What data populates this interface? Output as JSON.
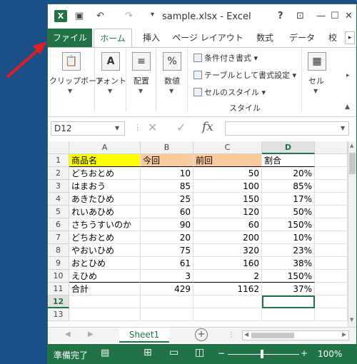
{
  "title_bar": {
    "title": "sample.xlsx - Excel",
    "help": "?",
    "minimize": "—",
    "maximize": "☐",
    "close": "✕"
  },
  "tabs": [
    "ファイル",
    "ホーム",
    "挿入",
    "ページ レイアウト",
    "数式",
    "データ",
    "校"
  ],
  "ribbon": {
    "clipboard": "クリップボード",
    "font": "フォント",
    "alignment": "配置",
    "number": "数値",
    "number_icon": "%",
    "font_icon": "A",
    "style_items": [
      "条件付き書式",
      "テーブルとして書式設定",
      "セルのスタイル"
    ],
    "styles_group": "スタイル",
    "cells": "セル"
  },
  "formula_bar": {
    "name_box": "D12",
    "fx": "fx"
  },
  "columns": [
    "A",
    "B",
    "C",
    "D"
  ],
  "rows": [
    [
      "1",
      "商品名",
      "今回",
      "前回",
      "割合"
    ],
    [
      "2",
      "どちおとめ",
      "10",
      "50",
      "20%"
    ],
    [
      "3",
      "はまおう",
      "85",
      "100",
      "85%"
    ],
    [
      "4",
      "あきたひめ",
      "25",
      "150",
      "17%"
    ],
    [
      "5",
      "れいあひめ",
      "60",
      "120",
      "50%"
    ],
    [
      "6",
      "さちうすいのか",
      "90",
      "60",
      "150%"
    ],
    [
      "7",
      "どちおとめ",
      "20",
      "200",
      "10%"
    ],
    [
      "8",
      "やおいひめ",
      "75",
      "320",
      "23%"
    ],
    [
      "9",
      "おとひめ",
      "61",
      "160",
      "38%"
    ],
    [
      "10",
      "えひめ",
      "3",
      "2",
      "150%"
    ],
    [
      "11",
      "合計",
      "429",
      "1162",
      "37%"
    ],
    [
      "12",
      "",
      "",
      "",
      ""
    ],
    [
      "13",
      "",
      "",
      "",
      ""
    ]
  ],
  "sheet_tab": "Sheet1",
  "status": {
    "ready": "準備完了",
    "zoom": "100%"
  },
  "colors": {
    "excel_green": "#217346",
    "header_yellow": "#ffff00",
    "header_orange": "#f9cb9c",
    "arrow_red": "#e02020"
  }
}
